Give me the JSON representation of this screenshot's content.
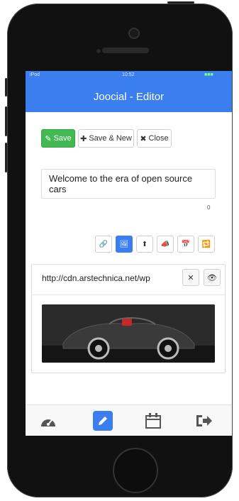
{
  "status_bar": {
    "carrier": "iPod",
    "time": "10:52",
    "battery": "■■■"
  },
  "header": {
    "title": "Joocial - Editor"
  },
  "toolbar": {
    "save_label": "Save",
    "save_new_label": "Save & New",
    "close_label": "Close"
  },
  "editor": {
    "text": "Welcome to the era of open source cars",
    "char_count": "0"
  },
  "tools": [
    {
      "name": "link",
      "active": false,
      "icon": "🔗"
    },
    {
      "name": "image",
      "active": true,
      "icon": "🖼"
    },
    {
      "name": "upload",
      "active": false,
      "icon": "⬆"
    },
    {
      "name": "announce",
      "active": false,
      "icon": "📣"
    },
    {
      "name": "calendar",
      "active": false,
      "icon": "📅"
    },
    {
      "name": "repeat",
      "active": false,
      "icon": "🔁"
    }
  ],
  "attachment": {
    "url": "http://cdn.arstechnica.net/wp",
    "remove_label": "✕",
    "preview_label": "👁"
  },
  "nav": [
    {
      "name": "dashboard",
      "active": false
    },
    {
      "name": "editor",
      "active": true
    },
    {
      "name": "calendar",
      "active": false
    },
    {
      "name": "logout",
      "active": false
    }
  ],
  "colors": {
    "primary": "#3a7ef0",
    "success": "#43b853"
  }
}
